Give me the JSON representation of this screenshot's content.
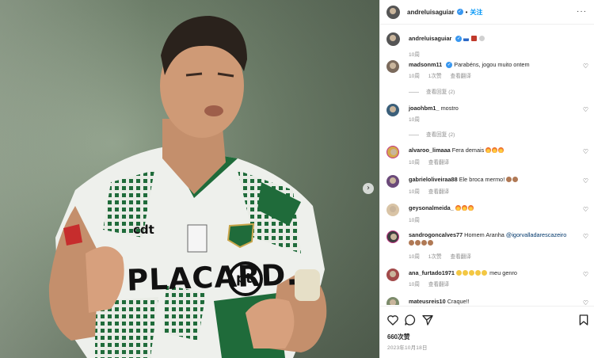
{
  "photo": {
    "sponsor_main": "PLACARD.",
    "sponsor_brand": "cdt",
    "sponsor_badge": "pt",
    "carousel_next_icon": "chevron-right-icon"
  },
  "header": {
    "username": "andreluisaguiar",
    "follow_label": "关注",
    "more_icon": "more-horizontal-icon"
  },
  "caption": {
    "username": "andreluisaguiar",
    "emojis": [
      "flag-icon",
      "flag-icon",
      "gray-emoji"
    ],
    "time": "10周"
  },
  "comments": [
    {
      "username": "madsonm11",
      "verified": true,
      "text": "Parabéns, jogou muito ontem",
      "time": "10周",
      "likes": "1次赞",
      "translate": "查看翻译",
      "replies": "查看回复 (2)"
    },
    {
      "username": "joaohbm1_",
      "text": "mostro",
      "time": "10周",
      "replies": "查看回复 (2)"
    },
    {
      "username": "alvaroo_limaaa",
      "text": "Fera demais",
      "emojis": "fire",
      "time": "10周",
      "translate": "查看翻译"
    },
    {
      "username": "gabrieloliveiraa88",
      "text": "Ele broca mermo!",
      "emojis": "pray",
      "time": "10周",
      "translate": "查看翻译"
    },
    {
      "username": "geysonalmeida_",
      "text": "",
      "emojis": "fire",
      "time": "10周"
    },
    {
      "username": "sandrogoncalves77",
      "text": "Homem Aranha",
      "mention": "@igorvalladarescazeiro",
      "emojis": "pray",
      "time": "10周",
      "likes": "1次赞",
      "translate": "查看翻译"
    },
    {
      "username": "ana_furtado1971",
      "text": "meu genro",
      "emojis": "clap",
      "time": "10周",
      "translate": "查看翻译"
    },
    {
      "username": "mateusreis10",
      "text": "Craque!!"
    }
  ],
  "actions": {
    "like_icon": "heart-icon",
    "comment_icon": "comment-icon",
    "share_icon": "send-icon",
    "save_icon": "bookmark-icon",
    "likes": "660次赞",
    "date": "2023年10月18日"
  },
  "colors": {
    "link_blue": "#0095f6",
    "verified_blue": "#3897f0",
    "meta_gray": "#8e8e8e",
    "kit_green": "#1f6b3a"
  }
}
